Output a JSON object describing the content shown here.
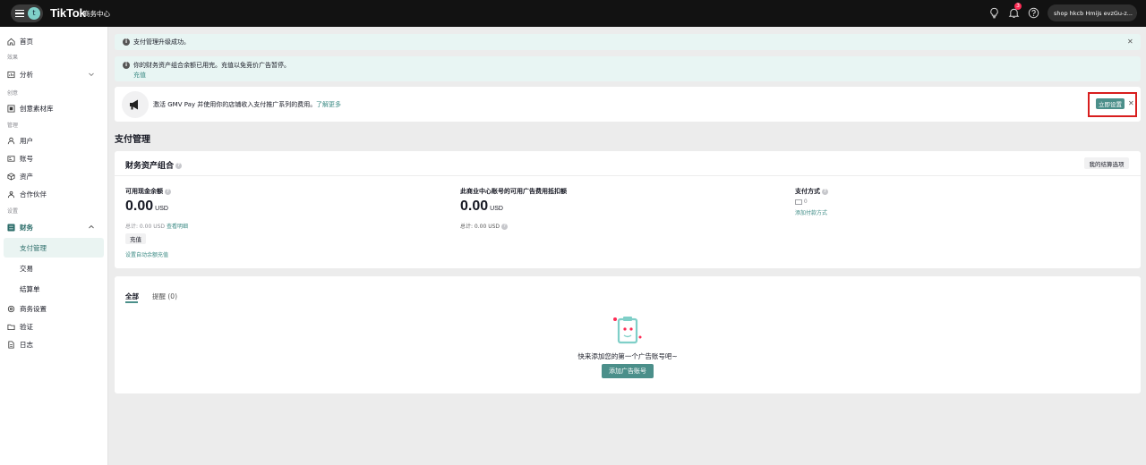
{
  "header": {
    "avatar_letter": "t",
    "brand": "TikTok",
    "brand_sub": "商务中心",
    "notification_count": "3",
    "account": "shop hkcb Hmijs evzGu-z..."
  },
  "sidebar": {
    "home": "首页",
    "group_effect": "效果",
    "analysis": "分析",
    "group_creative": "创意",
    "creative_library": "创意素材库",
    "group_manage": "管理",
    "users": "用户",
    "accounts": "账号",
    "assets": "资产",
    "partners": "合作伙伴",
    "group_settings": "设置",
    "finance": "财务",
    "payment_mgmt": "支付管理",
    "transactions": "交易",
    "statements": "结算单",
    "business_settings": "商务设置",
    "verification": "验证",
    "logs": "日志"
  },
  "banners": {
    "success": "支付管理升级成功。",
    "balance_text": "你的财务资产组合余额已用完。充值以免竞价广告暂停。",
    "balance_link": "充值",
    "promo_text": "激活 GMV Pay 并使用你的店铺收入支付推广系列的费用。",
    "promo_link": "了解更多",
    "promo_button": "立即设置"
  },
  "page": {
    "title": "支付管理"
  },
  "portfolio": {
    "title": "财务资产组合",
    "my_billing_button": "我的结算选项",
    "cash_label": "可用现金余额",
    "cash_value": "0.00",
    "cash_unit": "USD",
    "cash_total": "总计: 0.00 USD",
    "view_details": "查看明细",
    "recharge_button": "充值",
    "auto_recharge": "设置自动余额充值",
    "credit_label": "此商业中心账号的可用广告费用抵扣额",
    "credit_value": "0.00",
    "credit_unit": "USD",
    "credit_total": "总计: 0.00 USD",
    "payment_label": "支付方式",
    "payment_count": "0",
    "add_payment": "添加付款方式"
  },
  "accounts_card": {
    "tab_all": "全部",
    "tab_alerts": "提醒 (0)",
    "empty_text": "快来添加您的第一个广告账号吧~",
    "add_button": "添加广告账号"
  },
  "colors": {
    "accent": "#4b8f8a",
    "highlight": "#d81e1e",
    "banner_bg": "#e8f5f3"
  }
}
